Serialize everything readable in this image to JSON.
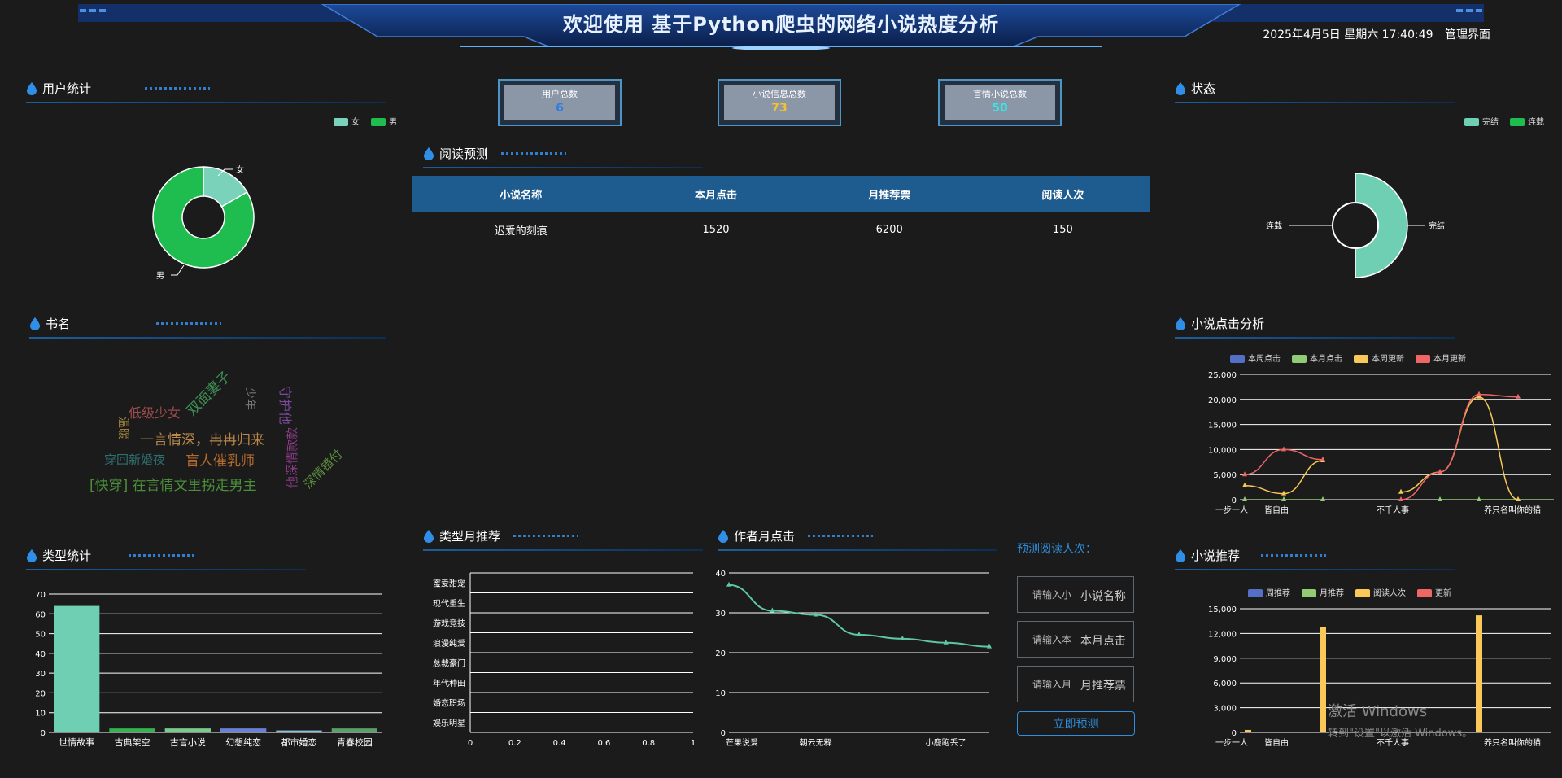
{
  "header": {
    "title": "欢迎使用 基于Python爬虫的网络小说热度分析",
    "datetime": "2025年4月5日 星期六 17:40:49",
    "admin_link": "管理界面"
  },
  "stats": [
    {
      "label": "用户总数",
      "value": "6",
      "color": "#2e7de0"
    },
    {
      "label": "小说信息总数",
      "value": "73",
      "color": "#f2c230"
    },
    {
      "label": "言情小说总数",
      "value": "50",
      "color": "#37e6e6"
    }
  ],
  "sections": {
    "user_stats": "用户统计",
    "status": "状态",
    "read_predict": "阅读预测",
    "book_names": "书名",
    "click_analysis": "小说点击分析",
    "type_stats": "类型统计",
    "type_month": "类型月推荐",
    "author_month": "作者月点击",
    "novel_recommend": "小说推荐"
  },
  "colors": {
    "female": "#79d2b9",
    "male": "#1fbd4f",
    "finished": "#6fcfb2",
    "serial": "#1fbd4f",
    "blue": "#5470c6",
    "green": "#91cc75",
    "yellow": "#fac858",
    "red": "#ee6666",
    "teal": "#5fc6a8"
  },
  "user_chart": {
    "legend": [
      "女",
      "男"
    ],
    "slices": [
      {
        "name": "女",
        "value": 1
      },
      {
        "name": "男",
        "value": 5
      }
    ]
  },
  "status_chart": {
    "legend": [
      "完结",
      "连载"
    ],
    "slices": [
      {
        "name": "完结",
        "value": 1
      },
      {
        "name": "连载",
        "value": 0
      }
    ]
  },
  "predict_table": {
    "headers": [
      "小说名称",
      "本月点击",
      "月推荐票",
      "阅读人次"
    ],
    "rows": [
      [
        "迟爱的刻痕",
        "1520",
        "6200",
        "150"
      ]
    ]
  },
  "word_cloud": [
    {
      "text": "低级少女",
      "color": "#9b4b4b",
      "size": 16
    },
    {
      "text": "双面妻子",
      "color": "#3d8d53",
      "size": 17
    },
    {
      "text": "少年",
      "color": "#777777",
      "size": 14
    },
    {
      "text": "守护他",
      "color": "#7d4a9c",
      "size": 16
    },
    {
      "text": "温暖",
      "color": "#9a7d3d",
      "size": 14
    },
    {
      "text": "一言情深，冉冉归来",
      "color": "#b9874a",
      "size": 17
    },
    {
      "text": "穿回新婚夜",
      "color": "#2e6f6f",
      "size": 15
    },
    {
      "text": "盲人催乳师",
      "color": "#b36a2e",
      "size": 17
    },
    {
      "text": "他深情款款",
      "color": "#8a3a86",
      "size": 15
    },
    {
      "text": "深情错付",
      "color": "#5b8f3d",
      "size": 15
    },
    {
      "text": "[快穿] 在言情文里拐走男主",
      "color": "#4a8f3a",
      "size": 17
    }
  ],
  "click_chart": {
    "legend": [
      "本周点击",
      "本月点击",
      "本周更新",
      "本月更新"
    ],
    "yticks": [
      "0",
      "5,000",
      "10,000",
      "15,000",
      "20,000",
      "25,000"
    ],
    "xlabels": [
      "一步一人",
      "皆自由",
      "不千人事",
      "养只名叫你的猫"
    ]
  },
  "chart_data": [
    {
      "type": "bar",
      "title": "类型统计",
      "categories": [
        "世情故事",
        "古典架空",
        "古言小说",
        "幻想纯恋",
        "都市婚恋",
        "青春校园"
      ],
      "values": [
        64,
        2,
        2,
        2,
        1,
        2
      ],
      "ylim": [
        0,
        70
      ],
      "yticks": [
        0,
        10,
        20,
        30,
        40,
        50,
        60,
        70
      ]
    },
    {
      "type": "bar",
      "title": "类型月推荐",
      "orientation": "horizontal",
      "categories": [
        "蜜爱甜宠",
        "现代重生",
        "游戏竞技",
        "浪漫纯爱",
        "总裁豪门",
        "年代种田",
        "婚恋职场",
        "娱乐明星"
      ],
      "values": [
        0,
        0,
        0,
        0,
        0,
        0,
        0,
        0
      ],
      "xlim": [
        0,
        1
      ],
      "xticks": [
        "0",
        "0.2",
        "0.4",
        "0.6",
        "0.8",
        "1"
      ]
    },
    {
      "type": "line",
      "title": "作者月点击",
      "x": [
        "芒果说爱",
        "",
        "朝云无释",
        "",
        "",
        "小鹿跑丢了",
        ""
      ],
      "values": [
        37,
        30.5,
        29.5,
        24.5,
        23.5,
        22.5,
        21.5
      ],
      "ylim": [
        0,
        40
      ],
      "yticks": [
        0,
        10,
        20,
        30,
        40
      ]
    },
    {
      "type": "line",
      "title": "小说点击分析",
      "series": [
        {
          "name": "本周点击",
          "values": [
            null,
            null,
            null,
            null,
            null,
            null,
            null,
            null,
            null
          ]
        },
        {
          "name": "本月点击",
          "values": [
            0,
            0,
            0,
            null,
            null,
            0,
            0,
            0,
            0
          ]
        },
        {
          "name": "本周更新",
          "values": [
            2800,
            1200,
            7800,
            null,
            1500,
            5500,
            20500,
            0
          ]
        },
        {
          "name": "本月更新",
          "values": [
            5000,
            10000,
            8000,
            null,
            0,
            5500,
            21000,
            20500
          ]
        }
      ],
      "ylim": [
        0,
        25000
      ]
    },
    {
      "type": "bar",
      "title": "小说推荐",
      "legend": [
        "周推荐",
        "月推荐",
        "阅读人次",
        "更新"
      ],
      "categories": [
        "一步一人",
        "皆自由",
        "不千人事",
        "养只名叫你的猫"
      ],
      "series": [
        {
          "name": "阅读人次",
          "values": [
            300,
            12800,
            0,
            14200
          ]
        }
      ],
      "ylim": [
        0,
        15000
      ],
      "yticks": [
        "0",
        "3,000",
        "6,000",
        "9,000",
        "12,000",
        "15,000"
      ]
    }
  ],
  "form": {
    "label": "预测阅读人次：",
    "inputs": [
      {
        "placeholder": "请输入小",
        "value": "小说名称"
      },
      {
        "placeholder": "请输入本",
        "value": "本月点击"
      },
      {
        "placeholder": "请输入月",
        "value": "月推荐票"
      }
    ],
    "button": "立即预测"
  },
  "watermark": {
    "line1": "激活 Windows",
    "line2": "转到\"设置\"以激活 Windows。"
  }
}
